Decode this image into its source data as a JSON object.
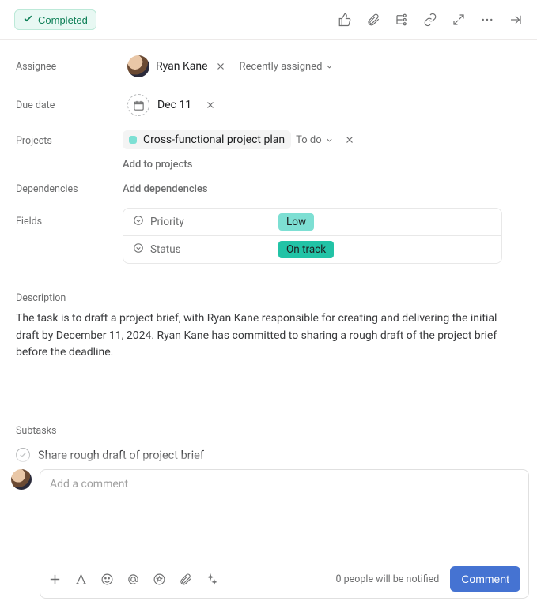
{
  "topbar": {
    "completed_label": "Completed"
  },
  "fields": {
    "assignee_label": "Assignee",
    "due_date_label": "Due date",
    "projects_label": "Projects",
    "dependencies_label": "Dependencies",
    "fields_label": "Fields"
  },
  "assignee": {
    "name": "Ryan Kane",
    "recent_label": "Recently assigned"
  },
  "due_date": {
    "text": "Dec 11"
  },
  "project": {
    "name": "Cross-functional project plan",
    "column": "To do",
    "add_label": "Add to projects"
  },
  "dependencies": {
    "add_label": "Add dependencies"
  },
  "custom_fields": {
    "priority_label": "Priority",
    "priority_value": "Low",
    "status_label": "Status",
    "status_value": "On track"
  },
  "description": {
    "heading": "Description",
    "text": "The task is to draft a project brief, with Ryan Kane responsible for creating and delivering the initial draft by December 11, 2024. Ryan Kane has committed to sharing a rough draft of the project brief before the deadline."
  },
  "subtasks": {
    "heading": "Subtasks",
    "items": [
      {
        "title": "Share rough draft of project brief"
      }
    ]
  },
  "comment": {
    "placeholder": "Add a comment",
    "notify_text": "0 people will be notified",
    "button_label": "Comment"
  }
}
